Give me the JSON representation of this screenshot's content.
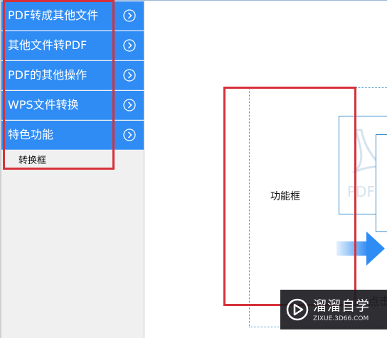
{
  "sidebar": {
    "items": [
      {
        "label": "PDF转成其他文件",
        "icon": "chevron-right-circle-icon"
      },
      {
        "label": "其他文件转PDF",
        "icon": "chevron-right-circle-icon"
      },
      {
        "label": "PDF的其他操作",
        "icon": "chevron-right-circle-icon"
      },
      {
        "label": "WPS文件转换",
        "icon": "chevron-right-circle-icon"
      },
      {
        "label": "特色功能",
        "icon": "chevron-right-circle-icon"
      }
    ],
    "sub_item": "转换框"
  },
  "canvas": {
    "function_box_label": "功能框",
    "pdf_card_text": "PDF",
    "click_text": "点击"
  },
  "watermark": {
    "brand": "溜溜自学",
    "url": "ZIXUE.3D66.COM"
  },
  "colors": {
    "menu_bg": "#2f8cf5",
    "highlight": "#d6313a",
    "frame": "#4a95c9"
  }
}
